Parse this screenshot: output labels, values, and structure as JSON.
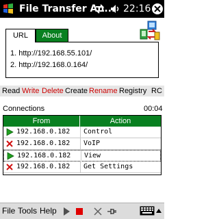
{
  "titlebar": {
    "title": "File Transfer An...",
    "clock": "22:16"
  },
  "tabs": [
    {
      "label": "URL"
    },
    {
      "label": "About"
    }
  ],
  "urls": [
    "1.  http://192.168.55.101/",
    "2.  http://192.168.0.164/"
  ],
  "commands": [
    {
      "label": "Read",
      "color": "#000000"
    },
    {
      "label": "Write",
      "color": "#cc0000"
    },
    {
      "label": "Delete",
      "color": "#cc0000"
    },
    {
      "label": "Create",
      "color": "#000000"
    },
    {
      "label": "Rename",
      "color": "#cc0000"
    },
    {
      "label": "Registry",
      "color": "#000000"
    },
    {
      "label": "RC",
      "color": "#000000"
    }
  ],
  "connections": {
    "label": "Connections",
    "time": "00:04",
    "columns": [
      "From",
      "Action"
    ],
    "rows": [
      {
        "status": "play-icon",
        "from": "192.168.0.182",
        "action": "Control"
      },
      {
        "status": "error-x-icon",
        "from": "192.168.0.182",
        "action": "VoIP"
      },
      {
        "status": "play-icon",
        "from": "192.168.0.182",
        "action": "View"
      },
      {
        "status": "error-x-icon",
        "from": "192.168.0.182",
        "action": "Get Settings"
      }
    ]
  },
  "menubar": {
    "file": "File",
    "tools": "Tools",
    "help": "Help"
  },
  "colors": {
    "accent": "#088020",
    "danger": "#cc0000",
    "titlebar": "#000000"
  }
}
